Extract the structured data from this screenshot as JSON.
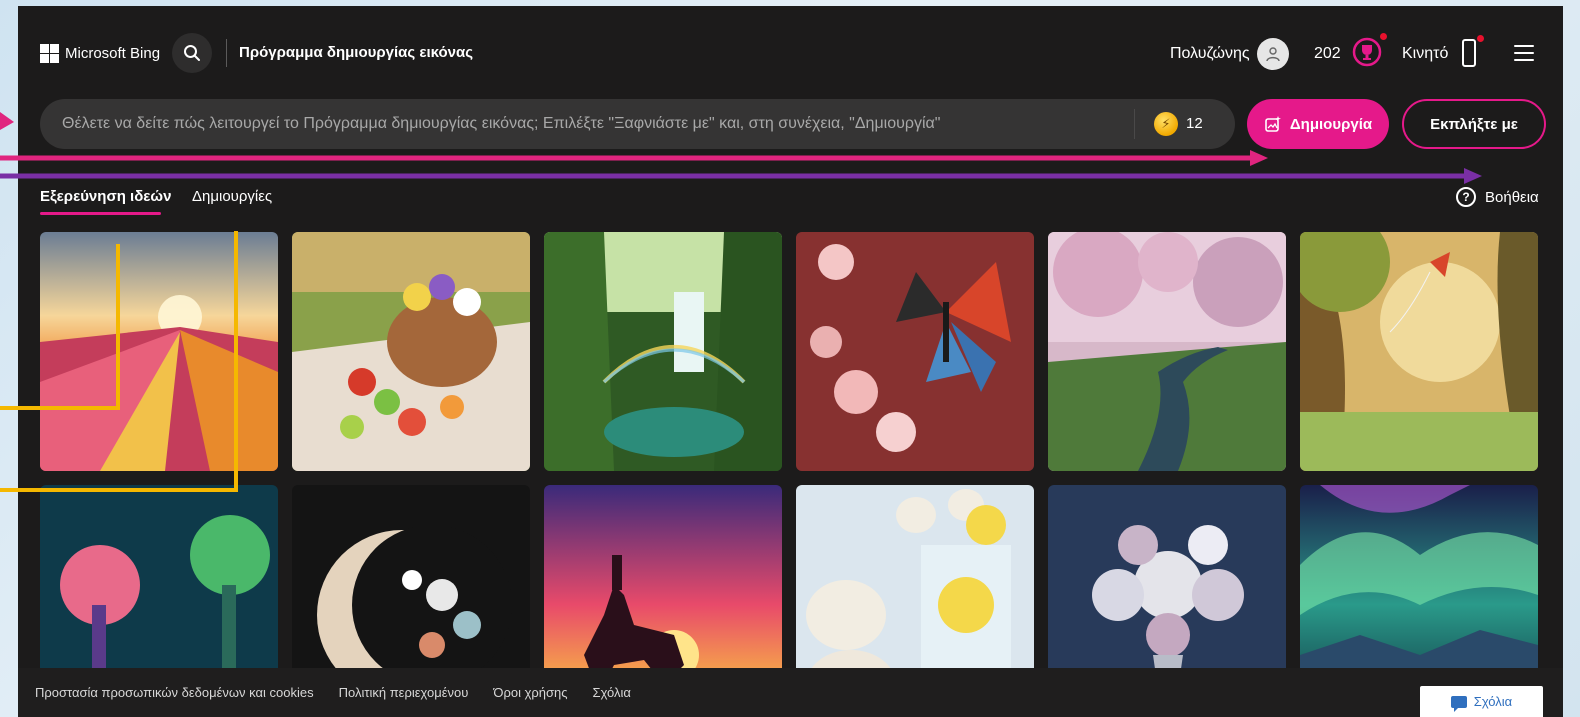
{
  "header": {
    "brand": "Microsoft Bing",
    "page_title": "Πρόγραμμα δημιουργίας εικόνας",
    "user_name": "Πολυζώνης",
    "points": "202",
    "mobile_label": "Κινητό"
  },
  "prompt": {
    "placeholder": "Θέλετε να δείτε πώς λειτουργεί το Πρόγραμμα δημιουργίας εικόνας; Επιλέξτε \"Ξαφνιάστε με\" και, στη συνέχεια, \"Δημιουργία\"",
    "boost_count": "12",
    "create_label": "Δημιουργία",
    "surprise_label": "Εκπλήξτε με"
  },
  "tabs": [
    {
      "label": "Εξερεύνηση ιδεών",
      "active": true
    },
    {
      "label": "Δημιουργίες",
      "active": false
    }
  ],
  "help_label": "Βοήθεια",
  "images": [
    {
      "subject": "tulip-field-sunset"
    },
    {
      "subject": "picnic-basket-fruits"
    },
    {
      "subject": "waterfall-rainbow-jungle"
    },
    {
      "subject": "butterfly-cherry-blossom"
    },
    {
      "subject": "cherry-blossom-park-stream"
    },
    {
      "subject": "kite-park-sunset"
    },
    {
      "subject": "neon-fantasy-trees"
    },
    {
      "subject": "crescent-moon-flowers"
    },
    {
      "subject": "horse-rider-sunset"
    },
    {
      "subject": "polar-bears-lemonade"
    },
    {
      "subject": "silver-flower-bouquet"
    },
    {
      "subject": "aurora-borealis"
    }
  ],
  "footer": {
    "links": [
      "Προστασία προσωπικών δεδομένων και cookies",
      "Πολιτική περιεχομένου",
      "Όροι χρήσης",
      "Σχόλια"
    ],
    "feedback_label": "Σχόλια"
  },
  "colors": {
    "accent": "#e5198a",
    "background": "#1c1b1b",
    "annotation_pink": "#e0257f",
    "annotation_purple": "#7a2fa5",
    "annotation_yellow": "#f5b800"
  }
}
